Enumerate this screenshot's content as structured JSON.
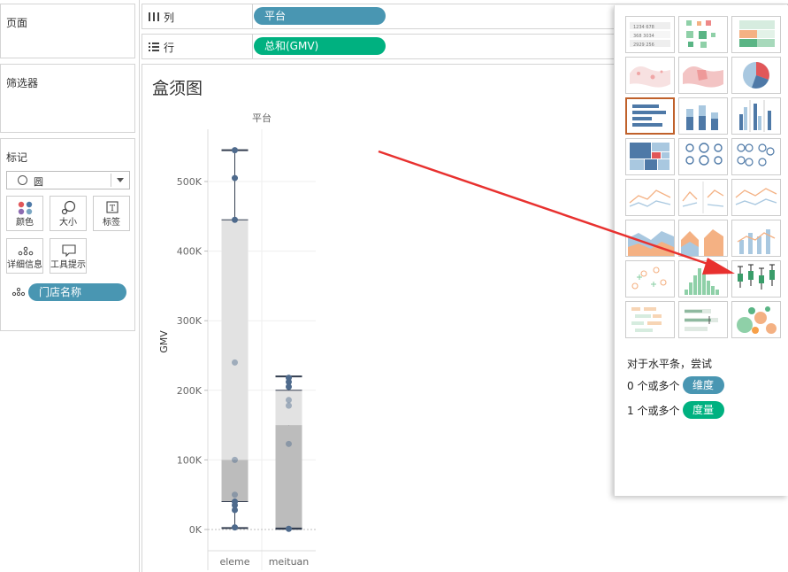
{
  "left": {
    "pages_title": "页面",
    "filters_title": "筛选器",
    "marks_title": "标记",
    "mark_type": "圆",
    "buttons": {
      "color": "颜色",
      "size": "大小",
      "label": "标签",
      "detail": "详细信息",
      "tooltip": "工具提示"
    },
    "detail_pill": "门店名称"
  },
  "shelves": {
    "columns_label": "列",
    "columns_pill": "平台",
    "rows_label": "行",
    "rows_pill": "总和(GMV)"
  },
  "view": {
    "title": "盒须图",
    "header": "平台",
    "ylabel": "GMV"
  },
  "chart_data": {
    "type": "box",
    "title": "盒须图",
    "column_header": "平台",
    "ylabel": "GMV",
    "ylim": [
      0,
      560000
    ],
    "yticks": [
      0,
      100000,
      200000,
      300000,
      400000,
      500000
    ],
    "ytick_labels": [
      "0K",
      "100K",
      "200K",
      "300K",
      "400K",
      "500K"
    ],
    "categories": [
      "eleme",
      "meituan"
    ],
    "boxes": [
      {
        "category": "eleme",
        "min": 2000,
        "q1": 40000,
        "median": 100000,
        "q3": 445000,
        "max": 545000
      },
      {
        "category": "meituan",
        "min": 1000,
        "q1": 2000,
        "median": 150000,
        "q3": 200000,
        "max": 220000
      }
    ],
    "points": [
      {
        "category": "eleme",
        "values": [
          545000,
          505000,
          445000,
          240000,
          100000,
          50000,
          40000,
          35000,
          28000,
          3000
        ]
      },
      {
        "category": "meituan",
        "values": [
          218000,
          212000,
          205000,
          186000,
          178000,
          123000,
          1000
        ]
      }
    ],
    "colors": {
      "box_upper": "#e2e2e2",
      "box_lower": "#bcbcbc",
      "point": "#4e6a8c",
      "whisker": "#333d4f"
    }
  },
  "show_me": {
    "hint_line1": "对于水平条，尝试",
    "dim_prefix": "0 个或多个",
    "dim_pill": "维度",
    "measure_prefix": "1 个或多个",
    "measure_pill": "度量",
    "colors": {
      "dimension": "#4996b2",
      "measure": "#00b180",
      "selected": "#c0612b"
    }
  },
  "arrow": {
    "color": "#e8312f"
  }
}
